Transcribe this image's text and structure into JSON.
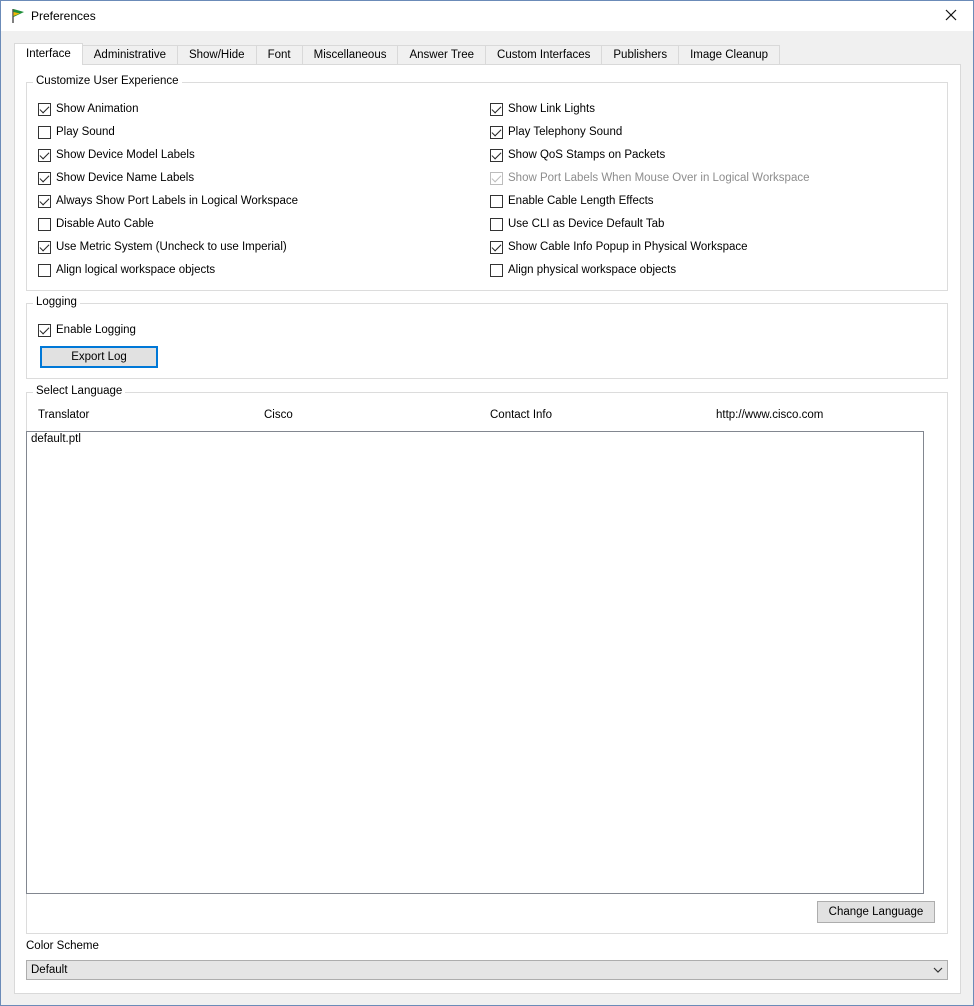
{
  "window": {
    "title": "Preferences"
  },
  "tabs": [
    {
      "label": "Interface",
      "active": true
    },
    {
      "label": "Administrative"
    },
    {
      "label": "Show/Hide"
    },
    {
      "label": "Font"
    },
    {
      "label": "Miscellaneous"
    },
    {
      "label": "Answer Tree"
    },
    {
      "label": "Custom Interfaces"
    },
    {
      "label": "Publishers"
    },
    {
      "label": "Image Cleanup"
    }
  ],
  "customize": {
    "title": "Customize User Experience",
    "left": [
      {
        "label": "Show Animation",
        "checked": true
      },
      {
        "label": "Play Sound",
        "checked": false
      },
      {
        "label": "Show Device Model Labels",
        "checked": true
      },
      {
        "label": "Show Device Name Labels",
        "checked": true
      },
      {
        "label": "Always Show Port Labels in Logical Workspace",
        "checked": true
      },
      {
        "label": "Disable Auto Cable",
        "checked": false
      },
      {
        "label": "Use Metric System (Uncheck to use Imperial)",
        "checked": true
      },
      {
        "label": "Align logical workspace objects",
        "checked": false
      }
    ],
    "right": [
      {
        "label": "Show Link Lights",
        "checked": true
      },
      {
        "label": "Play Telephony Sound",
        "checked": true
      },
      {
        "label": "Show QoS Stamps on Packets",
        "checked": true
      },
      {
        "label": "Show Port Labels When Mouse Over in Logical Workspace",
        "checked": true,
        "disabled": true
      },
      {
        "label": "Enable Cable Length Effects",
        "checked": false
      },
      {
        "label": "Use CLI as Device Default Tab",
        "checked": false
      },
      {
        "label": "Show Cable Info Popup in Physical Workspace",
        "checked": true
      },
      {
        "label": "Align physical workspace objects",
        "checked": false
      }
    ]
  },
  "logging": {
    "title": "Logging",
    "enable_label": "Enable Logging",
    "enable_checked": true,
    "export_label": "Export Log"
  },
  "language": {
    "title": "Select Language",
    "translator_label": "Translator",
    "translator_value": "Cisco",
    "contact_label": "Contact Info",
    "contact_value": "http://www.cisco.com",
    "items": [
      "default.ptl"
    ],
    "change_label": "Change Language"
  },
  "color_scheme": {
    "label": "Color Scheme",
    "selected": "Default"
  },
  "colors": {
    "accent": "#0078d7",
    "check": "#222222",
    "disabled_text": "#8d8d8d"
  }
}
